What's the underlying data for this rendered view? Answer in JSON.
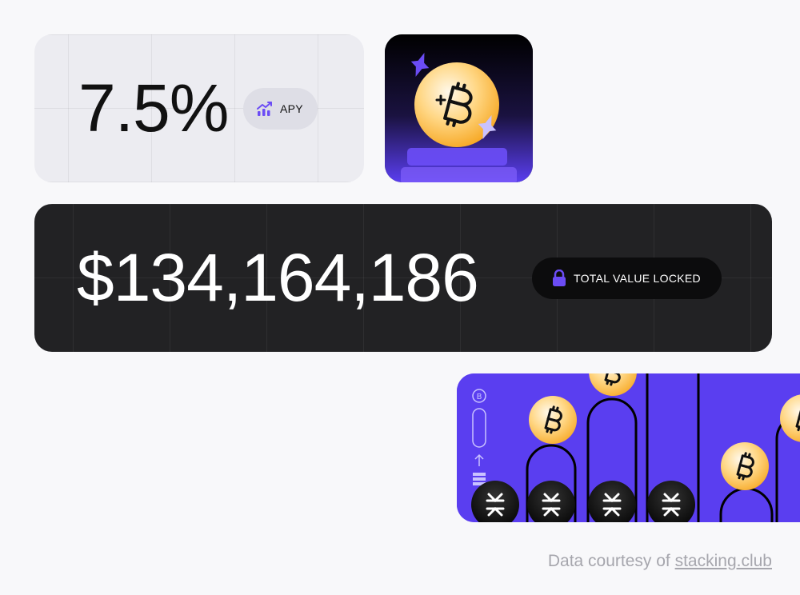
{
  "apy": {
    "value": "7.5%",
    "label": "APY",
    "icon": "chart-trending-up-icon"
  },
  "coin_card": {
    "icon": "bitcoin-coin-icon"
  },
  "tvl": {
    "value": "$134,164,186",
    "label": "TOTAL VALUE LOCKED",
    "icon": "lock-icon"
  },
  "stacking_illustration": {
    "coin_icon": "bitcoin-coin-icon",
    "token_icon": "stacks-token-icon"
  },
  "footer": {
    "prefix": "Data courtesy of",
    "link_text": "stacking.club"
  },
  "colors": {
    "accent": "#6b4cf5",
    "coin": "#f7a823",
    "dark_card": "#222224",
    "light_card": "#ececf1"
  }
}
